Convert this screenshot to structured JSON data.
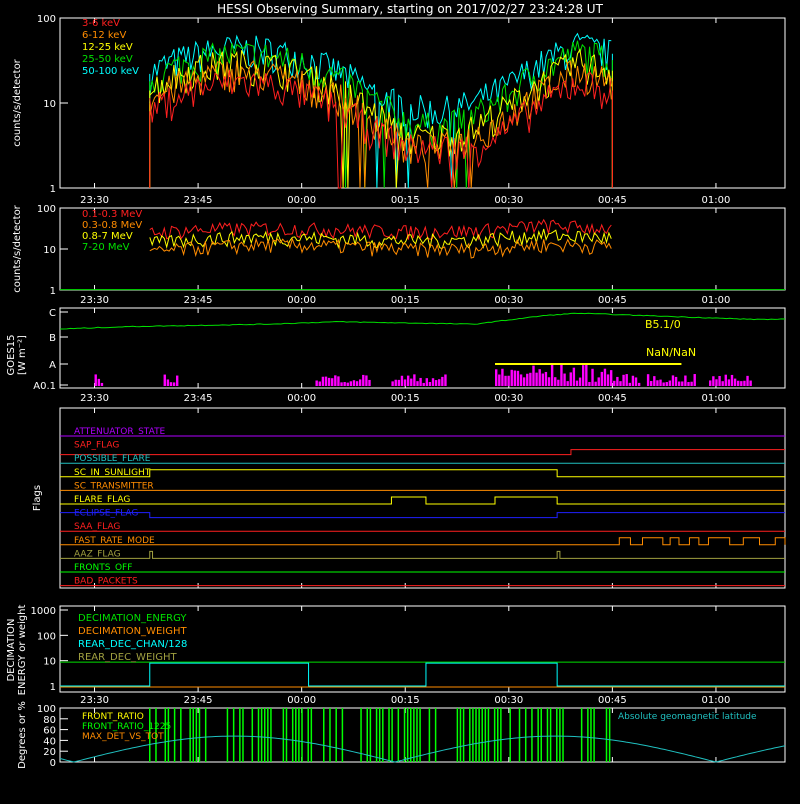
{
  "title": "HESSI Observing Summary, starting on 2017/02/27 23:24:28 UT",
  "time_ticks": [
    "23:30",
    "23:45",
    "00:00",
    "00:15",
    "00:30",
    "00:45",
    "01:00"
  ],
  "colors": {
    "red": "#ff2020",
    "orange": "#ff8c00",
    "yellow": "#ffff00",
    "green": "#00e000",
    "cyan": "#00ffff",
    "magenta": "#ff00ff",
    "purple": "#b000ff",
    "blue": "#2020ff",
    "white": "#ffffff",
    "olive": "#a0a040",
    "lime": "#00ff00",
    "teal": "#20c0c0"
  },
  "chart_data": [
    {
      "id": "low-energy",
      "type": "line",
      "ylabel": "counts/s/detector",
      "yscale": "log",
      "ylim": [
        1,
        100
      ],
      "yticks": [
        "1",
        "10",
        "100"
      ],
      "legend": [
        {
          "name": "3-6 keV",
          "color": "red"
        },
        {
          "name": "6-12 keV",
          "color": "orange"
        },
        {
          "name": "12-25 keV",
          "color": "yellow"
        },
        {
          "name": "25-50 keV",
          "color": "green"
        },
        {
          "name": "50-100 keV",
          "color": "cyan"
        }
      ],
      "x_minutes": [
        13,
        16,
        20,
        25,
        30,
        35,
        40,
        45,
        50,
        55,
        60,
        65,
        70,
        75,
        80
      ],
      "series": [
        {
          "name": "50-100 keV",
          "color": "cyan",
          "values": [
            22,
            30,
            38,
            44,
            42,
            34,
            24,
            14,
            9,
            8,
            10,
            16,
            30,
            48,
            38
          ]
        },
        {
          "name": "25-50 keV",
          "color": "green",
          "values": [
            18,
            25,
            32,
            38,
            36,
            29,
            20,
            11,
            6,
            5,
            7,
            12,
            25,
            40,
            32
          ]
        },
        {
          "name": "12-25 keV",
          "color": "yellow",
          "values": [
            14,
            20,
            26,
            30,
            28,
            22,
            15,
            8,
            4,
            4,
            5,
            9,
            18,
            30,
            24
          ]
        },
        {
          "name": "6-12 keV",
          "color": "orange",
          "values": [
            10,
            15,
            20,
            24,
            22,
            17,
            12,
            7,
            3,
            3,
            4,
            7,
            14,
            24,
            18
          ]
        },
        {
          "name": "3-6 keV",
          "color": "red",
          "values": [
            8,
            11,
            15,
            18,
            17,
            13,
            9,
            5,
            3,
            3,
            3,
            5,
            10,
            18,
            14
          ]
        }
      ]
    },
    {
      "id": "high-energy",
      "type": "line",
      "ylabel": "counts/s/detector",
      "yscale": "log",
      "ylim": [
        1,
        100
      ],
      "yticks": [
        "1",
        "10",
        "100"
      ],
      "legend": [
        {
          "name": "0.1-0.3 MeV",
          "color": "red"
        },
        {
          "name": "0.3-0.8 MeV",
          "color": "orange"
        },
        {
          "name": "0.8-7 MeV",
          "color": "yellow"
        },
        {
          "name": "7-20 MeV",
          "color": "green"
        }
      ],
      "x_minutes": [
        13,
        20,
        30,
        40,
        50,
        60,
        70,
        80
      ],
      "series": [
        {
          "name": "0.1-0.3 MeV",
          "color": "red",
          "values": [
            25,
            30,
            33,
            30,
            27,
            28,
            38,
            32
          ]
        },
        {
          "name": "0.3-0.8 MeV",
          "color": "orange",
          "values": [
            8,
            11,
            13,
            12,
            10,
            10,
            13,
            12
          ]
        },
        {
          "name": "0.8-7 MeV",
          "color": "yellow",
          "values": [
            14,
            18,
            20,
            18,
            16,
            17,
            22,
            19
          ]
        },
        {
          "name": "7-20 MeV",
          "color": "green",
          "values": [
            1,
            1,
            1,
            1,
            1,
            1,
            1,
            1
          ]
        }
      ]
    },
    {
      "id": "goes",
      "type": "line",
      "ylabel": "GOES15",
      "ylabel2": "[W m⁻²]",
      "yticks": [
        "A0.1",
        "A",
        "B",
        "C"
      ],
      "annotations": [
        "B5.1/0",
        "NaN/NaN"
      ],
      "x_minutes": [
        0,
        10,
        20,
        30,
        40,
        50,
        60,
        70,
        75,
        80,
        90,
        100
      ],
      "series": [
        {
          "name": "",
          "color": "green",
          "values": [
            2.3,
            2.4,
            2.45,
            2.5,
            2.6,
            2.55,
            2.5,
            2.85,
            2.95,
            2.9,
            2.8,
            2.7
          ]
        }
      ],
      "magenta_segments": [
        [
          5,
          6
        ],
        [
          15,
          17
        ],
        [
          37,
          45
        ],
        [
          48,
          56
        ],
        [
          63,
          84
        ],
        [
          85,
          92
        ],
        [
          94,
          100
        ]
      ]
    },
    {
      "id": "flags",
      "type": "timeline",
      "ylabel": "Flags",
      "flags": [
        {
          "name": "ATTENUATOR_STATE",
          "color": "purple"
        },
        {
          "name": "SAP_FLAG",
          "color": "red"
        },
        {
          "name": "POSSIBLE_FLARE",
          "color": "teal"
        },
        {
          "name": "SC_IN_SUNLIGHT",
          "color": "yellow"
        },
        {
          "name": "SC_TRANSMITTER",
          "color": "orange"
        },
        {
          "name": "FLARE_FLAG",
          "color": "yellow"
        },
        {
          "name": "ECLIPSE_FLAG",
          "color": "blue"
        },
        {
          "name": "SAA_FLAG",
          "color": "red"
        },
        {
          "name": "FAST_RATE_MODE",
          "color": "orange"
        },
        {
          "name": "AAZ_FLAG",
          "color": "olive"
        },
        {
          "name": "FRONTS_OFF",
          "color": "lime"
        },
        {
          "name": "BAD_PACKETS",
          "color": "red"
        }
      ]
    },
    {
      "id": "decimation",
      "type": "line",
      "ylabel": "DECIMATION",
      "ylabel2": "ENERGY or weight",
      "yscale": "log",
      "yticks": [
        "1",
        "10",
        "100",
        "1000"
      ],
      "legend": [
        {
          "name": "DECIMATION_ENERGY",
          "color": "green"
        },
        {
          "name": "DECIMATION_WEIGHT",
          "color": "orange"
        },
        {
          "name": "REAR_DEC_CHAN/128",
          "color": "cyan"
        },
        {
          "name": "REAR_DEC_WEIGHT",
          "color": "olive"
        }
      ]
    },
    {
      "id": "ratio",
      "type": "line",
      "ylabel": "Degrees or %",
      "ylim": [
        0,
        100
      ],
      "yticks": [
        "0",
        "20",
        "40",
        "60",
        "80",
        "100"
      ],
      "legend": [
        {
          "name": "FRONT_RATIO",
          "color": "yellow"
        },
        {
          "name": "FRONT_RATIO_1225",
          "color": "lime"
        },
        {
          "name": "MAX_DET_VS_TOT",
          "color": "orange"
        }
      ],
      "right_label": {
        "name": "Absolute geomagnetic latitude",
        "color": "teal"
      }
    }
  ]
}
